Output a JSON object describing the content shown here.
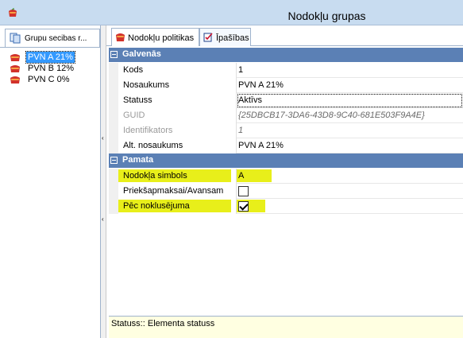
{
  "window": {
    "title": "Nodokļu grupas"
  },
  "left_panel": {
    "tab_label": "Grupu secibas r...",
    "items": [
      {
        "label": "PVN A 21%",
        "selected": true
      },
      {
        "label": "PVN B 12%",
        "selected": false
      },
      {
        "label": "PVN C 0%",
        "selected": false
      }
    ]
  },
  "tabs": [
    {
      "label": "Nodokļu politikas",
      "icon": "nodoklu-politikas-icon"
    },
    {
      "label": "Īpašības",
      "icon": "properties-checklist-icon"
    }
  ],
  "grid": {
    "categories": [
      {
        "label": "Galvenās"
      },
      {
        "label": "Pamata"
      }
    ],
    "general_rows": [
      {
        "name": "Kods",
        "value": "1"
      },
      {
        "name": "Nosaukums",
        "value": "PVN A 21%"
      },
      {
        "name": "Statuss",
        "value": "Aktīvs"
      },
      {
        "name": "GUID",
        "value": "{25DBCB17-3DA6-43D8-9C40-681E503F9A4E}"
      },
      {
        "name": "Identifikators",
        "value": "1"
      },
      {
        "name": "Alt. nosaukums",
        "value": "PVN A 21%"
      }
    ],
    "base_rows": [
      {
        "name": "Nodokļa simbols",
        "value": "A"
      },
      {
        "name": "Priekšapmaksai/Avansam",
        "checked": false
      },
      {
        "name": "Pēc noklusējuma",
        "checked": true
      }
    ]
  },
  "status": {
    "text": "Statuss:: Elementa statuss"
  },
  "colors": {
    "titlebar": "#c8dcf0",
    "category_header": "#5b80b5",
    "highlight": "#e8ef1a",
    "selection": "#3399ff",
    "status_bg": "#ffffe1"
  }
}
